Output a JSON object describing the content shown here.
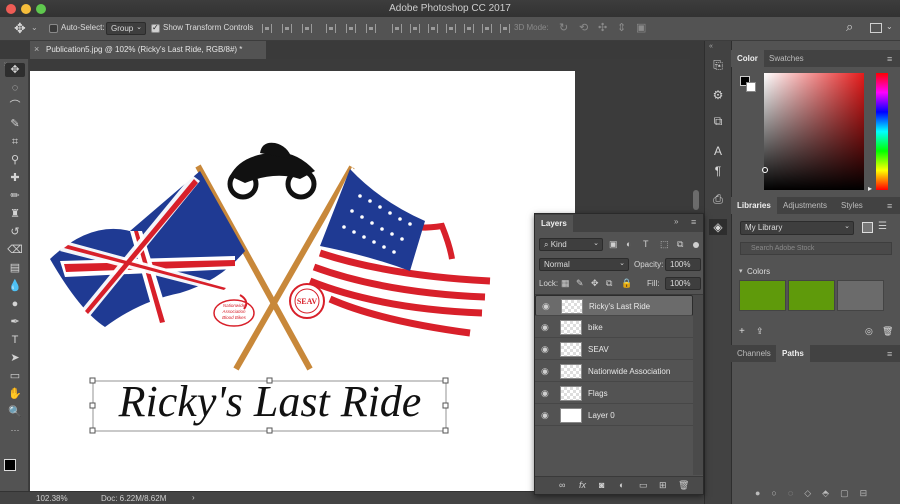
{
  "app": {
    "title": "Adobe Photoshop CC 2017",
    "traffic_colors": [
      "#ee5c55",
      "#f5bd3b",
      "#5fc84e"
    ]
  },
  "options_bar": {
    "auto_select_label": "Auto-Select:",
    "auto_select_value": "Group",
    "show_transform_label": "Show Transform Controls",
    "mode_3d_label": "3D Mode:"
  },
  "document": {
    "tab_title": "Publication5.jpg @ 102% (Ricky's Last Ride, RGB/8#) *",
    "zoom": "102.38%",
    "doc_size": "Doc: 6.22M/8.62M",
    "headline": "Ricky's Last Ride",
    "badge_left": [
      "Nationwide",
      "Association",
      "Blood Bikes"
    ],
    "badge_right": "SEAV"
  },
  "color_panel": {
    "tabs": [
      "Color",
      "Swatches"
    ],
    "hue_colors": [
      "#ff0000",
      "#ffff00",
      "#00ff00",
      "#00ffff",
      "#0000ff",
      "#ff00ff",
      "#ff0000"
    ],
    "field_base": "#e51b1b"
  },
  "libraries_panel": {
    "tabs": [
      "Libraries",
      "Adjustments",
      "Styles"
    ],
    "library": "My Library",
    "search_placeholder": "Search Adobe Stock",
    "colors_header": "Colors",
    "swatches": [
      "#5f9a0b",
      "#5f9a0b",
      "#6b6b6b"
    ]
  },
  "channels_panel": {
    "tabs": [
      "Channels",
      "Paths"
    ]
  },
  "layers_panel": {
    "title": "Layers",
    "kind_label": "Kind",
    "blend_mode": "Normal",
    "opacity_label": "Opacity:",
    "opacity_value": "100%",
    "lock_label": "Lock:",
    "fill_label": "Fill:",
    "fill_value": "100%",
    "layers": [
      {
        "name": "Ricky's Last Ride",
        "selected": true
      },
      {
        "name": "bike",
        "selected": false
      },
      {
        "name": "SEAV",
        "selected": false
      },
      {
        "name": "Nationwide Association",
        "selected": false
      },
      {
        "name": "Flags",
        "selected": false
      },
      {
        "name": "Layer 0",
        "selected": false
      }
    ]
  }
}
